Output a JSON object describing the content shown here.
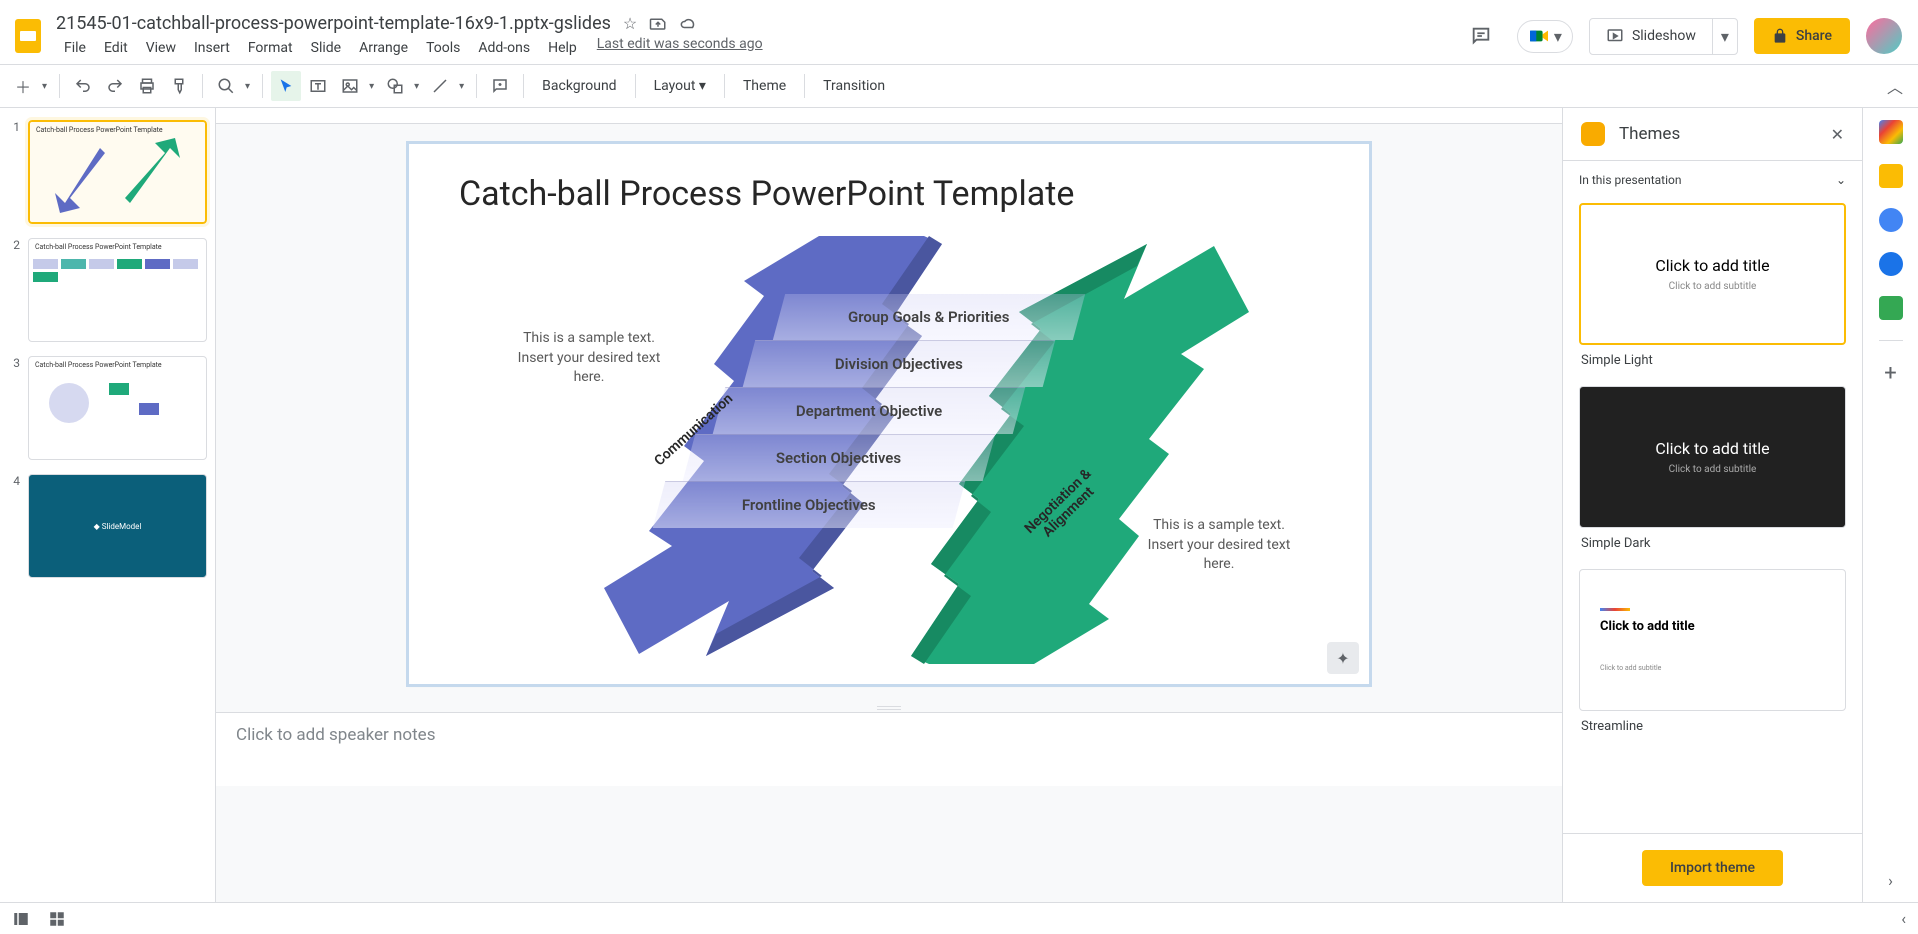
{
  "header": {
    "title": "21545-01-catchball-process-powerpoint-template-16x9-1.pptx-gslides",
    "last_edit": "Last edit was seconds ago",
    "slideshow": "Slideshow",
    "share": "Share",
    "menu": [
      "File",
      "Edit",
      "View",
      "Insert",
      "Format",
      "Slide",
      "Arrange",
      "Tools",
      "Add-ons",
      "Help"
    ]
  },
  "toolbar": {
    "background": "Background",
    "layout": "Layout",
    "theme": "Theme",
    "transition": "Transition"
  },
  "slide": {
    "title": "Catch-ball Process PowerPoint Template",
    "sample_left": "This is a sample text.\nInsert your desired text here.",
    "sample_right": "This is a sample text.\nInsert your desired text here.",
    "comm": "Communication",
    "nego_l1": "Negotiation &",
    "nego_l2": "Alignment",
    "levels": [
      "Group Goals & Priorities",
      "Division Objectives",
      "Department Objective",
      "Section Objectives",
      "Frontline Objectives"
    ]
  },
  "notes": {
    "placeholder": "Click to add speaker notes"
  },
  "themes": {
    "title": "Themes",
    "section": "In this presentation",
    "list": [
      {
        "name": "Simple Light",
        "title": "Click to add title",
        "sub": "Click to add subtitle"
      },
      {
        "name": "Simple Dark",
        "title": "Click to add title",
        "sub": "Click to add subtitle"
      },
      {
        "name": "Streamline",
        "title": "Click to add title",
        "sub": "Click to add subtitle"
      }
    ],
    "import": "Import theme"
  },
  "thumbs": [
    "1",
    "2",
    "3",
    "4"
  ]
}
